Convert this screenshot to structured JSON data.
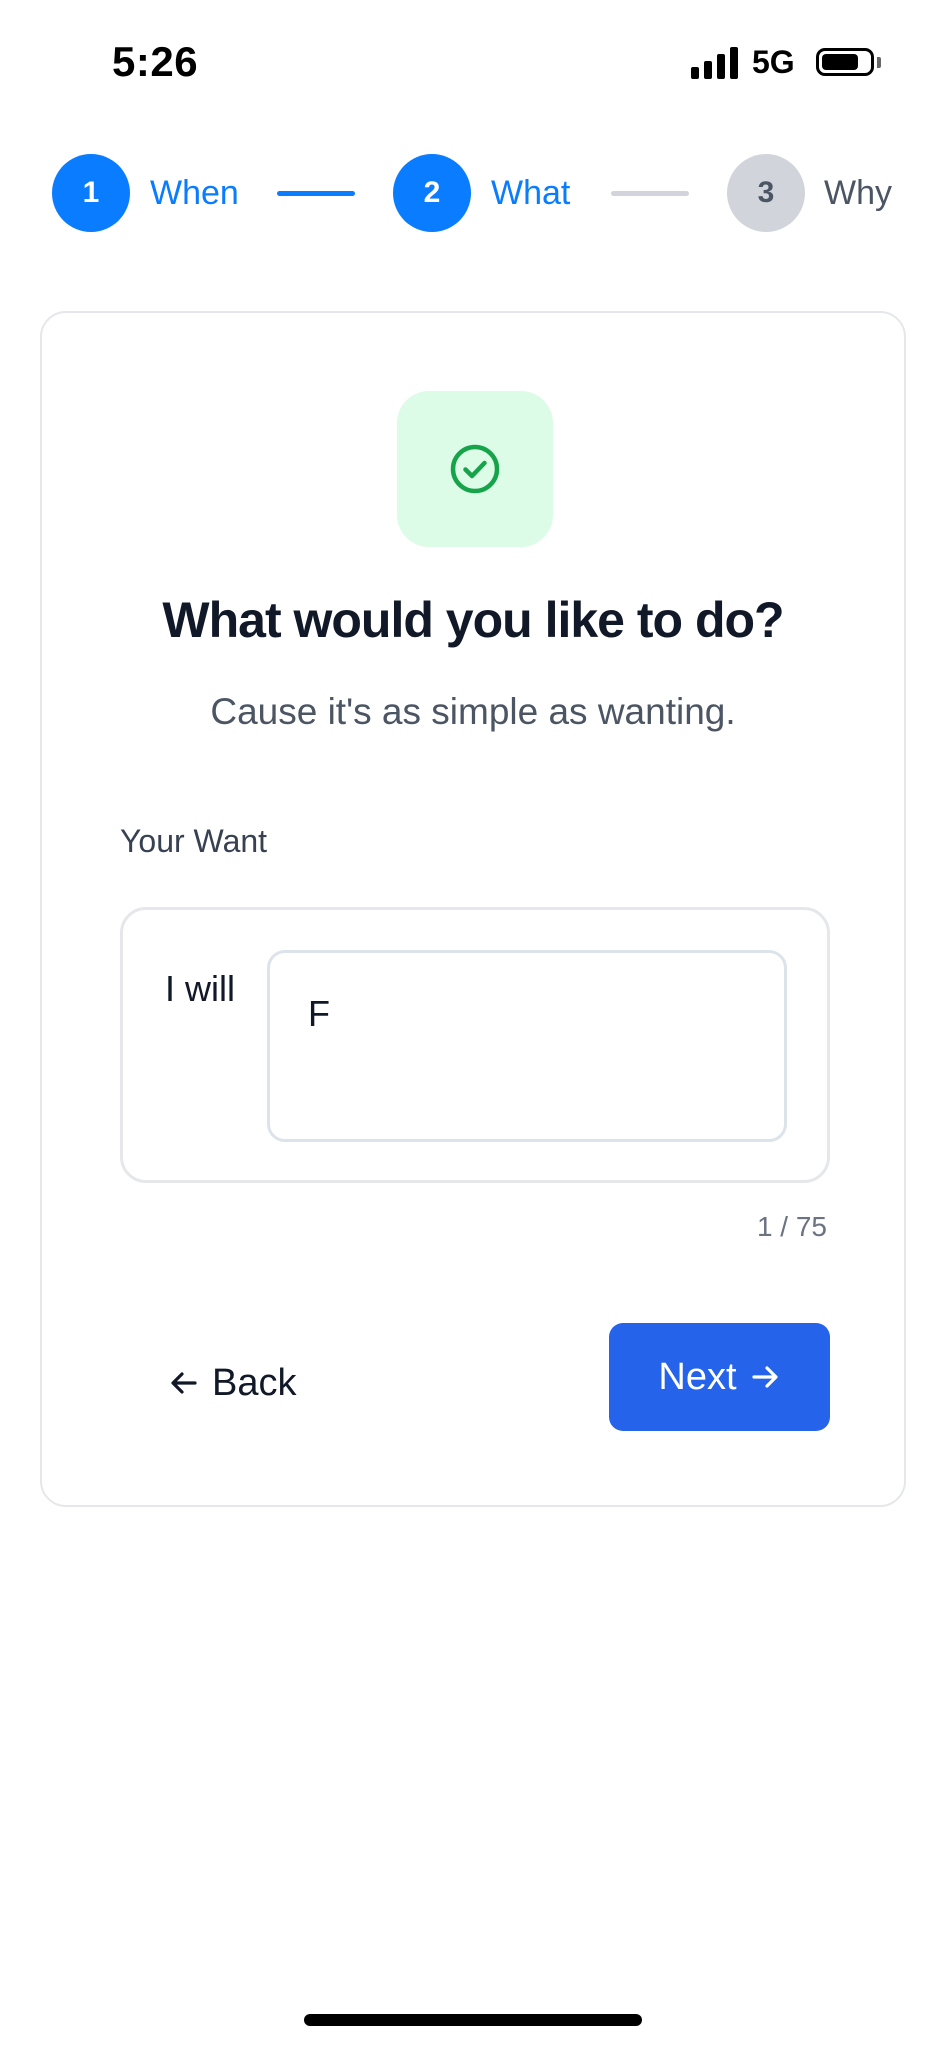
{
  "status_bar": {
    "time": "5:26",
    "network": "5G",
    "battery_level": 0.8
  },
  "stepper": {
    "steps": [
      {
        "number": "1",
        "label": "When",
        "state": "active"
      },
      {
        "number": "2",
        "label": "What",
        "state": "active"
      },
      {
        "number": "3",
        "label": "Why",
        "state": "inactive"
      }
    ]
  },
  "card": {
    "icon": "check-circle-icon",
    "title": "What would you like to do?",
    "subtitle": "Cause it's as simple as wanting.",
    "field_label": "Your Want",
    "prefix": "I will",
    "input_value": "F",
    "counter": "1 / 75",
    "back_label": "Back",
    "next_label": "Next"
  },
  "colors": {
    "accent": "#0a7cff",
    "primary_button": "#2563eb",
    "icon_tile": "#dcfce7",
    "icon_green": "#16a34a",
    "inactive_step": "#d1d5db"
  }
}
